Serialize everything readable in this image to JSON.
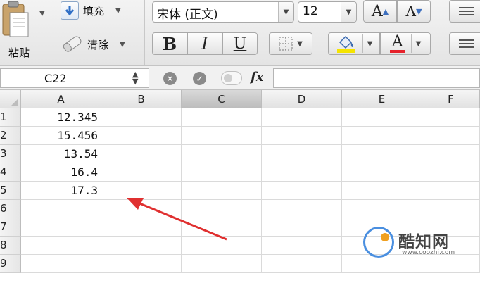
{
  "ribbon": {
    "paste_label": "粘贴",
    "fill_label": "填充",
    "clear_label": "清除",
    "font_name": "宋体 (正文)",
    "font_size": "12",
    "grow_font": "A",
    "shrink_font": "A",
    "bold": "B",
    "italic": "I",
    "underline": "U",
    "font_color_glyph": "A",
    "colors": {
      "highlight": "#f5e400",
      "font_color": "#e6222b"
    }
  },
  "formula_bar": {
    "name_box": "C22",
    "fx": "fx",
    "formula": ""
  },
  "grid": {
    "columns": [
      "A",
      "B",
      "C",
      "D",
      "E",
      "F"
    ],
    "selected_column": "C",
    "rows": [
      "1",
      "2",
      "3",
      "4",
      "5",
      "6",
      "7",
      "8",
      "9"
    ],
    "column_a_values": [
      "12.345",
      "15.456",
      "13.54",
      "16.4",
      "17.3",
      "",
      "",
      "",
      ""
    ]
  },
  "annotation": {
    "arrow_color": "#e03030",
    "icon": "red-arrow-icon"
  },
  "watermark": {
    "brand": "酷知网",
    "url": "www.coozhi.com"
  }
}
